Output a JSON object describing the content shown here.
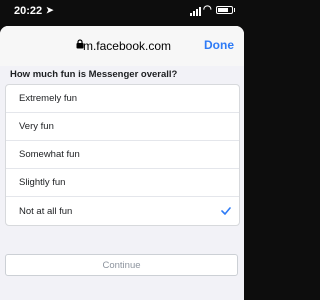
{
  "status_bar": {
    "time": "20:22"
  },
  "browser": {
    "url": "m.facebook.com",
    "done_label": "Done"
  },
  "survey": {
    "question": "How much fun is Messenger overall?",
    "options": [
      {
        "label": "Extremely fun",
        "selected": false
      },
      {
        "label": "Very fun",
        "selected": false
      },
      {
        "label": "Somewhat fun",
        "selected": false
      },
      {
        "label": "Slightly fun",
        "selected": false
      },
      {
        "label": "Not at all fun",
        "selected": true
      }
    ],
    "continue_label": "Continue"
  },
  "colors": {
    "accent": "#2e7bf6",
    "disabled_text": "#8d949e"
  }
}
